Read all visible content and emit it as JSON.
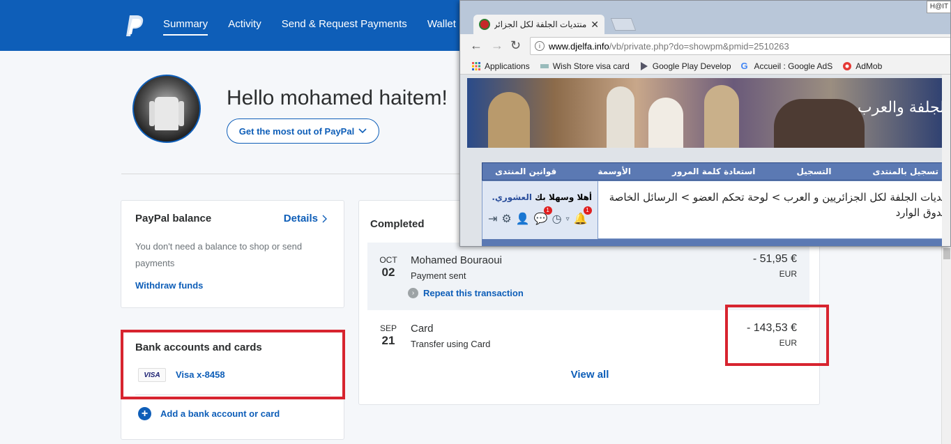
{
  "paypal": {
    "nav": [
      "Summary",
      "Activity",
      "Send & Request Payments",
      "Wallet"
    ],
    "hello": "Hello mohamed haitem!",
    "cta": "Get the most out of PayPal",
    "balance": {
      "title": "PayPal balance",
      "details": "Details",
      "desc": "You don't need a balance to shop or send payments",
      "withdraw": "Withdraw funds"
    },
    "bank": {
      "title": "Bank accounts and cards",
      "visa_logo": "VISA",
      "visa_label": "Visa x-8458",
      "add": "Add a bank account or card"
    },
    "activity": {
      "title": "Completed",
      "transactions": [
        {
          "month": "OCT",
          "day": "02",
          "name": "Mohamed Bouraoui",
          "sub": "Payment sent",
          "amount": "- 51,95 €",
          "currency": "EUR",
          "repeat": "Repeat this transaction"
        },
        {
          "month": "SEP",
          "day": "21",
          "name": "Card",
          "sub": "Transfer using Card",
          "amount": "- 143,53 €",
          "currency": "EUR"
        }
      ],
      "view_all": "View all"
    }
  },
  "browser": {
    "tab_title": "منتديات الجلفة لكل الجزائريين و",
    "user_badge": "H@IT",
    "url_host": "www.djelfa.info",
    "url_rest": "/vb/private.php?do=showpm&pmid=2510263",
    "bookmarks": [
      "Applications",
      "Wish Store visa card",
      "Google Play Develop",
      "Accueil : Google AdS",
      "AdMob"
    ],
    "banner_logo": "الجلفة والعرب",
    "forum_nav": [
      "تسجيل بالمنتدى",
      "التسجيل",
      "استعادة كلمة المرور",
      "الأوسمة",
      "قوانين المنتدى"
    ],
    "welcome_prefix": "أهلا وسهلا بك",
    "welcome_user": "العشوري.",
    "breadcrumb_line1": "منتديات الجلفة لكل الجزائريين و العرب > لوحة تحكم العضو > الرسائل الخاصة >",
    "breadcrumb_line2": "صندوق الوارد",
    "notif_count_1": "1",
    "notif_count_2": "1"
  }
}
